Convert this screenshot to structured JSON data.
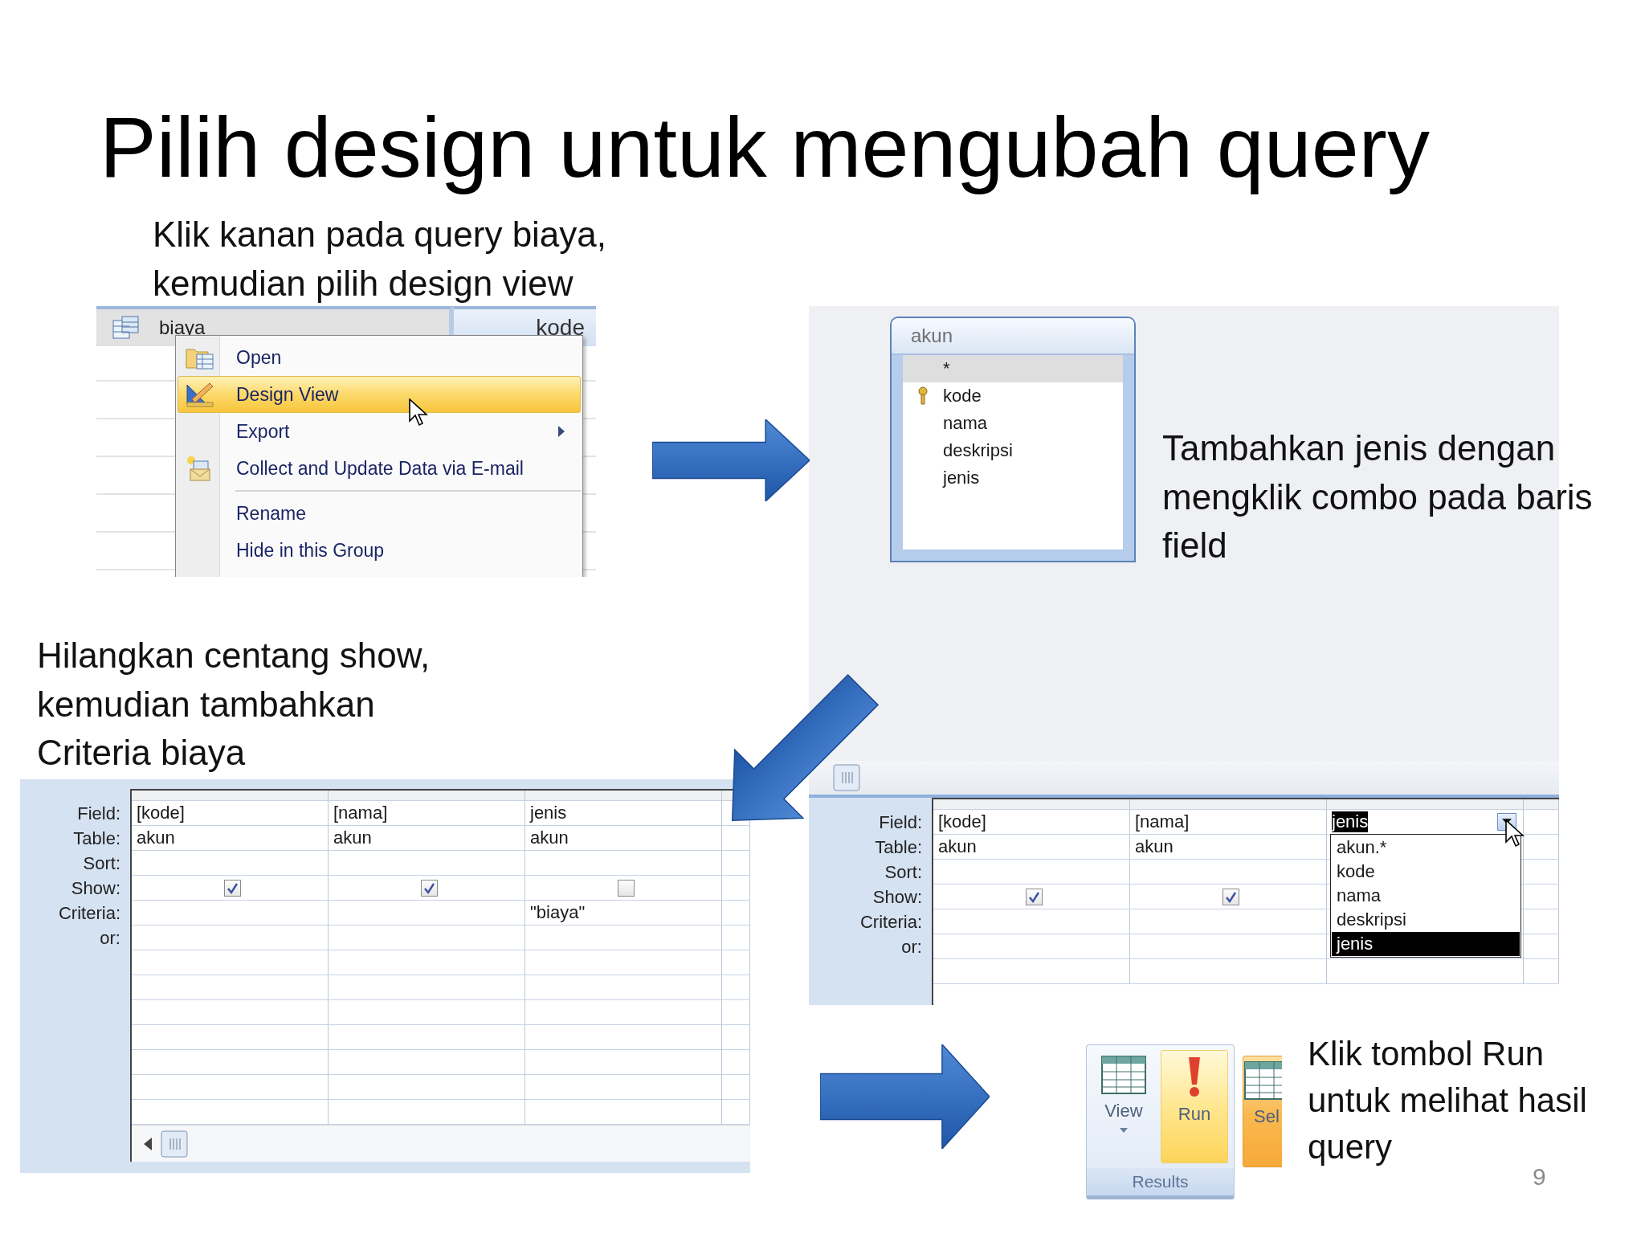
{
  "title": "Pilih design untuk mengubah query",
  "notes": [
    {
      "lines": [
        "Klik kanan pada query biaya,",
        "kemudian pilih design view"
      ]
    },
    {
      "lines": [
        "Tambahkan jenis dengan",
        "mengklik combo pada baris",
        "field"
      ]
    },
    {
      "lines": [
        "Hilangkan centang show,",
        "kemudian tambahkan",
        "Criteria biaya"
      ]
    },
    {
      "lines": [
        "Klik tombol Run",
        "untuk melihat hasil",
        "query"
      ]
    }
  ],
  "navigation_pane": {
    "item": "biaya",
    "column_header": "kode"
  },
  "context_menu": {
    "items": [
      {
        "label": "Open",
        "kind": "command",
        "selected": false,
        "separator_before": false
      },
      {
        "label": "Design View",
        "kind": "command",
        "selected": true,
        "separator_before": false
      },
      {
        "label": "Export",
        "kind": "submenu",
        "selected": false,
        "separator_before": false
      },
      {
        "label": "Collect and Update Data via E-mail",
        "kind": "command",
        "selected": false,
        "separator_before": false
      },
      {
        "label": "Rename",
        "kind": "command",
        "selected": false,
        "separator_before": true
      },
      {
        "label": "Hide in this Group",
        "kind": "command",
        "selected": false,
        "separator_before": false
      }
    ]
  },
  "table_box": {
    "title": "akun",
    "fields": [
      {
        "name": "*",
        "primary_key": false,
        "selected": true
      },
      {
        "name": "kode",
        "primary_key": true,
        "selected": false
      },
      {
        "name": "nama",
        "primary_key": false,
        "selected": false
      },
      {
        "name": "deskripsi",
        "primary_key": false,
        "selected": false
      },
      {
        "name": "jenis",
        "primary_key": false,
        "selected": false
      }
    ]
  },
  "query_grid_right": {
    "row_labels": [
      "Field:",
      "Table:",
      "Sort:",
      "Show:",
      "Criteria:",
      "or:"
    ],
    "columns": [
      {
        "field": "[kode]",
        "field_selected": false,
        "table": "akun",
        "show": true
      },
      {
        "field": "[nama]",
        "field_selected": false,
        "table": "akun",
        "show": true
      },
      {
        "field": "jenis",
        "field_selected": true,
        "dropdown": {
          "options": [
            {
              "label": "akun.*",
              "selected": false
            },
            {
              "label": "kode",
              "selected": false
            },
            {
              "label": "nama",
              "selected": false
            },
            {
              "label": "deskripsi",
              "selected": false
            },
            {
              "label": "jenis",
              "selected": true
            }
          ]
        }
      }
    ]
  },
  "query_grid_left": {
    "row_labels": [
      "Field:",
      "Table:",
      "Sort:",
      "Show:",
      "Criteria:",
      "or:"
    ],
    "columns": [
      {
        "field": "[kode]",
        "field_selected": false,
        "table": "akun",
        "show": true
      },
      {
        "field": "[nama]",
        "field_selected": false,
        "table": "akun",
        "show": true
      },
      {
        "field": "jenis",
        "field_selected": false,
        "table": "akun",
        "show": false,
        "criteria": "\"biaya\""
      }
    ]
  },
  "ribbon": {
    "buttons": [
      {
        "label": "View",
        "kind": "view",
        "highlighted": false
      },
      {
        "label": "Run",
        "kind": "run",
        "highlighted": true
      },
      {
        "label": "Sel",
        "kind": "select",
        "highlighted": true
      }
    ],
    "group_label": "Results"
  },
  "page_number": "9"
}
